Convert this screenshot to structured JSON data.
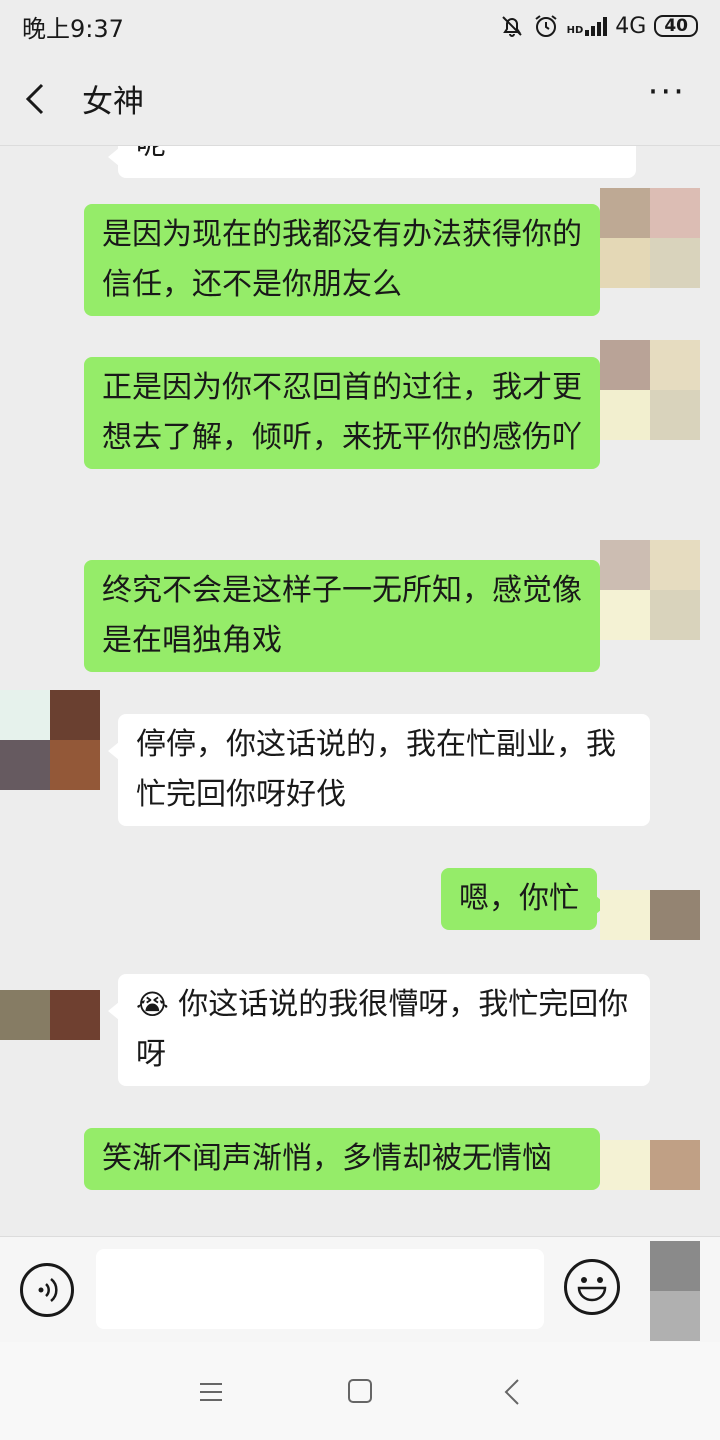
{
  "status": {
    "time": "晚上9:37",
    "network": "4G",
    "hd": "HD",
    "battery": "40"
  },
  "header": {
    "title": "女神"
  },
  "messages": [
    {
      "side": "other",
      "text": "呢"
    },
    {
      "side": "me",
      "text": "是因为现在的我都没有办法获得你的信任，还不是你朋友么"
    },
    {
      "side": "me",
      "text": "正是因为你不忍回首的过往，我才更想去了解，倾听，来抚平你的感伤吖"
    },
    {
      "side": "me",
      "text": "终究不会是这样子一无所知，感觉像是在唱独角戏"
    },
    {
      "side": "other",
      "text": "停停，你这话说的，我在忙副业，我忙完回你呀好伐"
    },
    {
      "side": "me",
      "text": "嗯，你忙"
    },
    {
      "side": "other",
      "emoji": "😭",
      "text": "你这话说的我很懵呀，我忙完回你呀"
    },
    {
      "side": "me",
      "text": "笑渐不闻声渐悄，多情却被无情恼"
    }
  ],
  "input": {
    "value": ""
  },
  "icons": {
    "back": "chevron-left-icon",
    "more": "more-icon",
    "voice": "voice-icon",
    "emoji": "emoji-icon",
    "menu": "menu-icon",
    "home": "home-icon",
    "nav_back": "back-icon"
  },
  "colors": {
    "my_bubble": "#95ec69",
    "other_bubble": "#ffffff",
    "background": "#ededed"
  }
}
